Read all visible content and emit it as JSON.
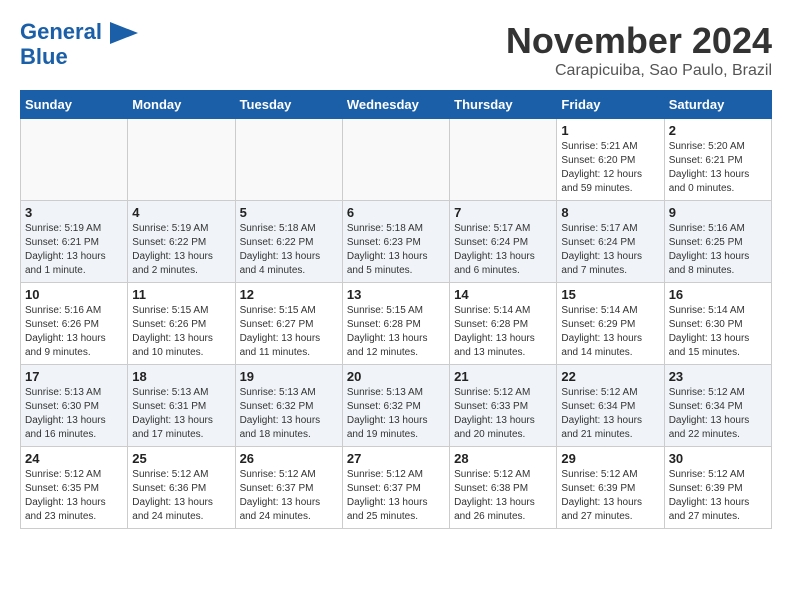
{
  "header": {
    "logo_line1": "General",
    "logo_line2": "Blue",
    "month": "November 2024",
    "location": "Carapicuiba, Sao Paulo, Brazil"
  },
  "weekdays": [
    "Sunday",
    "Monday",
    "Tuesday",
    "Wednesday",
    "Thursday",
    "Friday",
    "Saturday"
  ],
  "weeks": [
    {
      "rowClass": "week-row-1",
      "days": [
        {
          "num": "",
          "info": "",
          "empty": true
        },
        {
          "num": "",
          "info": "",
          "empty": true
        },
        {
          "num": "",
          "info": "",
          "empty": true
        },
        {
          "num": "",
          "info": "",
          "empty": true
        },
        {
          "num": "",
          "info": "",
          "empty": true
        },
        {
          "num": "1",
          "info": "Sunrise: 5:21 AM\nSunset: 6:20 PM\nDaylight: 12 hours\nand 59 minutes.",
          "empty": false
        },
        {
          "num": "2",
          "info": "Sunrise: 5:20 AM\nSunset: 6:21 PM\nDaylight: 13 hours\nand 0 minutes.",
          "empty": false
        }
      ]
    },
    {
      "rowClass": "week-row-2",
      "days": [
        {
          "num": "3",
          "info": "Sunrise: 5:19 AM\nSunset: 6:21 PM\nDaylight: 13 hours\nand 1 minute.",
          "empty": false
        },
        {
          "num": "4",
          "info": "Sunrise: 5:19 AM\nSunset: 6:22 PM\nDaylight: 13 hours\nand 2 minutes.",
          "empty": false
        },
        {
          "num": "5",
          "info": "Sunrise: 5:18 AM\nSunset: 6:22 PM\nDaylight: 13 hours\nand 4 minutes.",
          "empty": false
        },
        {
          "num": "6",
          "info": "Sunrise: 5:18 AM\nSunset: 6:23 PM\nDaylight: 13 hours\nand 5 minutes.",
          "empty": false
        },
        {
          "num": "7",
          "info": "Sunrise: 5:17 AM\nSunset: 6:24 PM\nDaylight: 13 hours\nand 6 minutes.",
          "empty": false
        },
        {
          "num": "8",
          "info": "Sunrise: 5:17 AM\nSunset: 6:24 PM\nDaylight: 13 hours\nand 7 minutes.",
          "empty": false
        },
        {
          "num": "9",
          "info": "Sunrise: 5:16 AM\nSunset: 6:25 PM\nDaylight: 13 hours\nand 8 minutes.",
          "empty": false
        }
      ]
    },
    {
      "rowClass": "week-row-3",
      "days": [
        {
          "num": "10",
          "info": "Sunrise: 5:16 AM\nSunset: 6:26 PM\nDaylight: 13 hours\nand 9 minutes.",
          "empty": false
        },
        {
          "num": "11",
          "info": "Sunrise: 5:15 AM\nSunset: 6:26 PM\nDaylight: 13 hours\nand 10 minutes.",
          "empty": false
        },
        {
          "num": "12",
          "info": "Sunrise: 5:15 AM\nSunset: 6:27 PM\nDaylight: 13 hours\nand 11 minutes.",
          "empty": false
        },
        {
          "num": "13",
          "info": "Sunrise: 5:15 AM\nSunset: 6:28 PM\nDaylight: 13 hours\nand 12 minutes.",
          "empty": false
        },
        {
          "num": "14",
          "info": "Sunrise: 5:14 AM\nSunset: 6:28 PM\nDaylight: 13 hours\nand 13 minutes.",
          "empty": false
        },
        {
          "num": "15",
          "info": "Sunrise: 5:14 AM\nSunset: 6:29 PM\nDaylight: 13 hours\nand 14 minutes.",
          "empty": false
        },
        {
          "num": "16",
          "info": "Sunrise: 5:14 AM\nSunset: 6:30 PM\nDaylight: 13 hours\nand 15 minutes.",
          "empty": false
        }
      ]
    },
    {
      "rowClass": "week-row-4",
      "days": [
        {
          "num": "17",
          "info": "Sunrise: 5:13 AM\nSunset: 6:30 PM\nDaylight: 13 hours\nand 16 minutes.",
          "empty": false
        },
        {
          "num": "18",
          "info": "Sunrise: 5:13 AM\nSunset: 6:31 PM\nDaylight: 13 hours\nand 17 minutes.",
          "empty": false
        },
        {
          "num": "19",
          "info": "Sunrise: 5:13 AM\nSunset: 6:32 PM\nDaylight: 13 hours\nand 18 minutes.",
          "empty": false
        },
        {
          "num": "20",
          "info": "Sunrise: 5:13 AM\nSunset: 6:32 PM\nDaylight: 13 hours\nand 19 minutes.",
          "empty": false
        },
        {
          "num": "21",
          "info": "Sunrise: 5:12 AM\nSunset: 6:33 PM\nDaylight: 13 hours\nand 20 minutes.",
          "empty": false
        },
        {
          "num": "22",
          "info": "Sunrise: 5:12 AM\nSunset: 6:34 PM\nDaylight: 13 hours\nand 21 minutes.",
          "empty": false
        },
        {
          "num": "23",
          "info": "Sunrise: 5:12 AM\nSunset: 6:34 PM\nDaylight: 13 hours\nand 22 minutes.",
          "empty": false
        }
      ]
    },
    {
      "rowClass": "week-row-5",
      "days": [
        {
          "num": "24",
          "info": "Sunrise: 5:12 AM\nSunset: 6:35 PM\nDaylight: 13 hours\nand 23 minutes.",
          "empty": false
        },
        {
          "num": "25",
          "info": "Sunrise: 5:12 AM\nSunset: 6:36 PM\nDaylight: 13 hours\nand 24 minutes.",
          "empty": false
        },
        {
          "num": "26",
          "info": "Sunrise: 5:12 AM\nSunset: 6:37 PM\nDaylight: 13 hours\nand 24 minutes.",
          "empty": false
        },
        {
          "num": "27",
          "info": "Sunrise: 5:12 AM\nSunset: 6:37 PM\nDaylight: 13 hours\nand 25 minutes.",
          "empty": false
        },
        {
          "num": "28",
          "info": "Sunrise: 5:12 AM\nSunset: 6:38 PM\nDaylight: 13 hours\nand 26 minutes.",
          "empty": false
        },
        {
          "num": "29",
          "info": "Sunrise: 5:12 AM\nSunset: 6:39 PM\nDaylight: 13 hours\nand 27 minutes.",
          "empty": false
        },
        {
          "num": "30",
          "info": "Sunrise: 5:12 AM\nSunset: 6:39 PM\nDaylight: 13 hours\nand 27 minutes.",
          "empty": false
        }
      ]
    }
  ]
}
